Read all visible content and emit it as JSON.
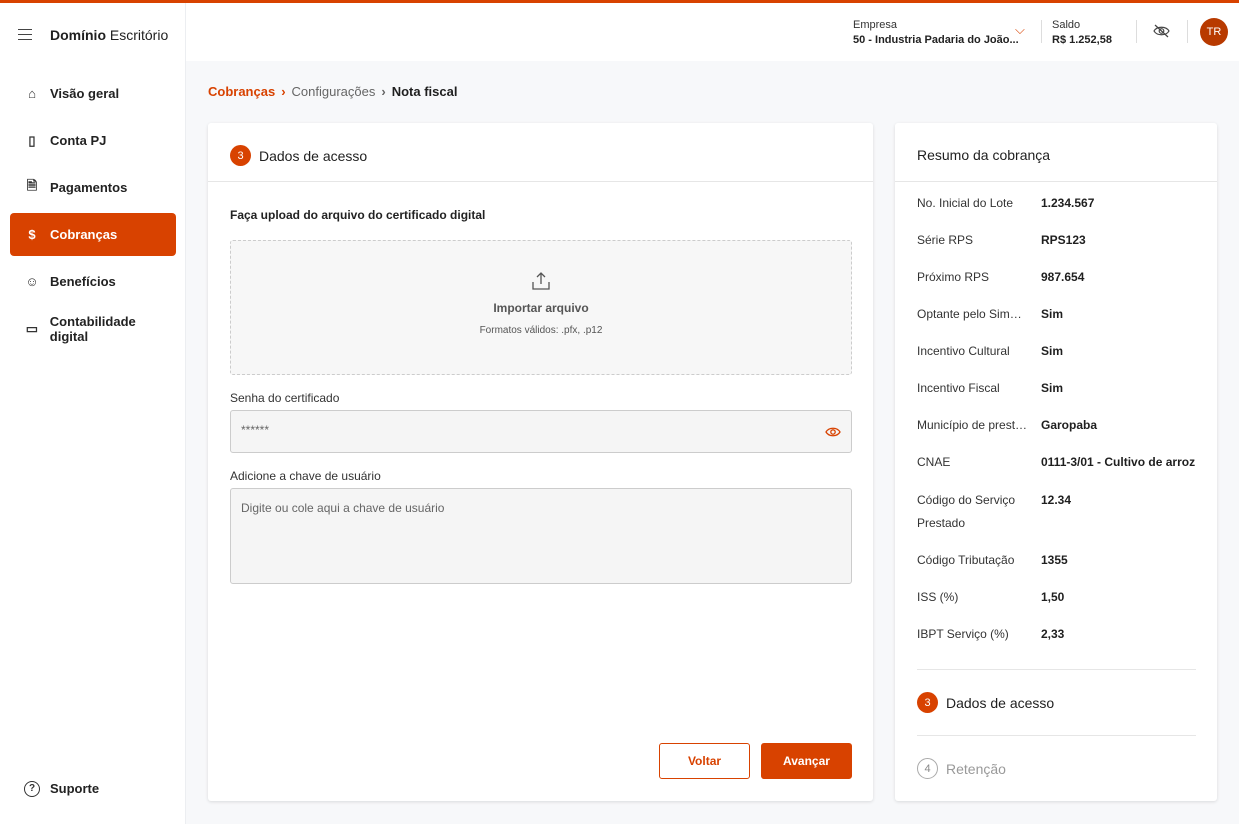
{
  "app": {
    "brand_bold": "Domínio",
    "brand_light": "Escritório"
  },
  "header": {
    "empresa_label": "Empresa",
    "empresa_value": "50 - Industria Padaria do João...",
    "saldo_label": "Saldo",
    "saldo_value": "R$ 1.252,58",
    "avatar": "TR"
  },
  "sidebar": {
    "items": [
      {
        "label": "Visão geral"
      },
      {
        "label": "Conta PJ"
      },
      {
        "label": "Pagamentos"
      },
      {
        "label": "Cobranças"
      },
      {
        "label": "Benefícios"
      },
      {
        "label": "Contabilidade digital"
      }
    ],
    "support": "Suporte"
  },
  "breadcrumb": [
    "Cobranças",
    "Configurações",
    "Nota fiscal"
  ],
  "form": {
    "step": "3",
    "title": "Dados de acesso",
    "upload_heading": "Faça upload do arquivo do certificado digital",
    "upload_label": "Importar arquivo",
    "upload_formats": "Formatos válidos: .pfx, .p12",
    "password_label": "Senha do certificado",
    "password_value": "******",
    "key_label": "Adicione a chave de usuário",
    "key_placeholder": "Digite ou cole aqui a chave de usuário",
    "back": "Voltar",
    "next": "Avançar"
  },
  "summary": {
    "title": "Resumo da cobrança",
    "rows": [
      {
        "k": "No. Inicial do Lote",
        "v": "1.234.567"
      },
      {
        "k": "Série RPS",
        "v": "RPS123"
      },
      {
        "k": "Próximo RPS",
        "v": "987.654"
      },
      {
        "k": "Optante pelo Sim…",
        "v": "Sim"
      },
      {
        "k": "Incentivo Cultural",
        "v": "Sim"
      },
      {
        "k": "Incentivo Fiscal",
        "v": "Sim"
      },
      {
        "k": "Município de prest…",
        "v": "Garopaba"
      },
      {
        "k": "CNAE",
        "v": "0111-3/01 - Cultivo de arroz"
      },
      {
        "k": "Código do Serviço Prestado",
        "v": "12.34"
      },
      {
        "k": "Código Tributação",
        "v": "1355"
      },
      {
        "k": "ISS (%)",
        "v": "1,50"
      },
      {
        "k": "IBPT Serviço (%)",
        "v": "2,33"
      }
    ],
    "steps": [
      {
        "n": "3",
        "label": "Dados de acesso"
      },
      {
        "n": "4",
        "label": "Retenção"
      }
    ]
  }
}
